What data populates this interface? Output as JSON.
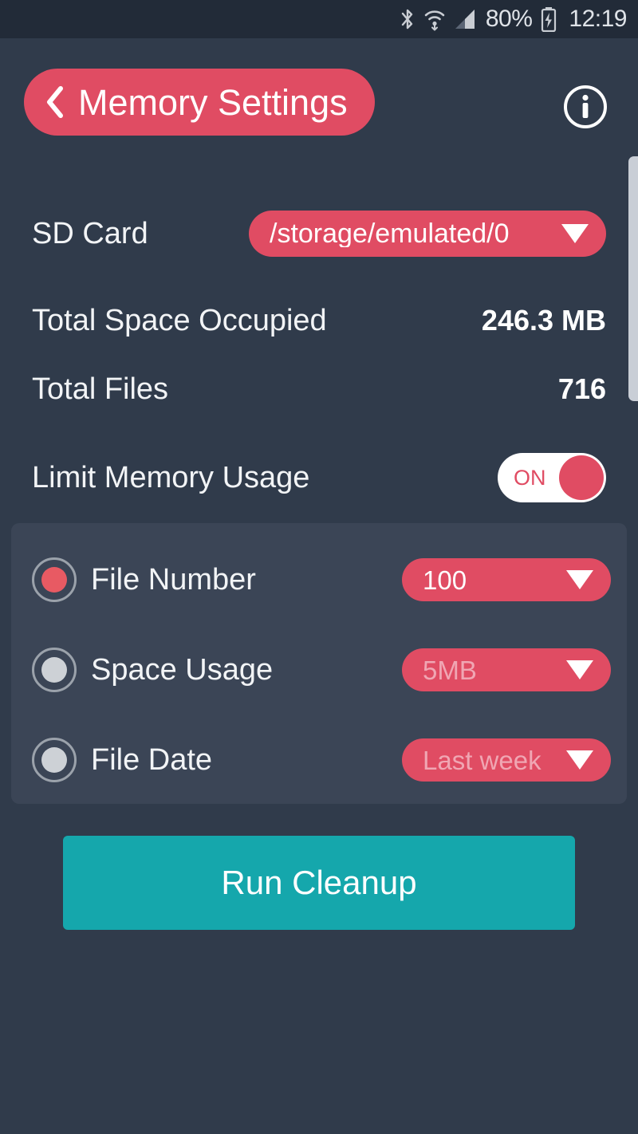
{
  "statusbar": {
    "icons": [
      "bluetooth-icon",
      "wifi-icon",
      "cellular-signal-icon",
      "battery-charging-icon"
    ],
    "battery_text": "80%",
    "time": "12:19"
  },
  "header": {
    "back_icon": "chevron-left-icon",
    "title": "Memory Settings",
    "info_icon": "info-icon",
    "accent_color": "#e04c63"
  },
  "rows": {
    "sd_card": {
      "label": "SD Card",
      "value": "/storage/emulated/0",
      "caret_icon": "caret-down-icon"
    },
    "total_space": {
      "label": "Total Space Occupied",
      "value": "246.3 MB"
    },
    "total_files": {
      "label": "Total Files",
      "value": "716"
    },
    "limit_memory": {
      "label": "Limit Memory Usage",
      "toggle_state": "ON"
    }
  },
  "radio_group": {
    "options": [
      {
        "label": "File Number",
        "selected": true,
        "dropdown_value": "100",
        "dimmed": false
      },
      {
        "label": "Space Usage",
        "selected": false,
        "dropdown_value": "5MB",
        "dimmed": true
      },
      {
        "label": "File Date",
        "selected": false,
        "dropdown_value": "Last week",
        "dimmed": true
      }
    ]
  },
  "cleanup": {
    "label": "Run Cleanup",
    "color": "#15a7ac"
  },
  "colors": {
    "page_background": "#303b4b",
    "statusbar_background": "#222b38",
    "panel_background": "#3b4556",
    "accent_pink": "#e04c63",
    "accent_teal": "#15a7ac"
  },
  "scrollbar": {
    "color": "#c9ced6"
  }
}
